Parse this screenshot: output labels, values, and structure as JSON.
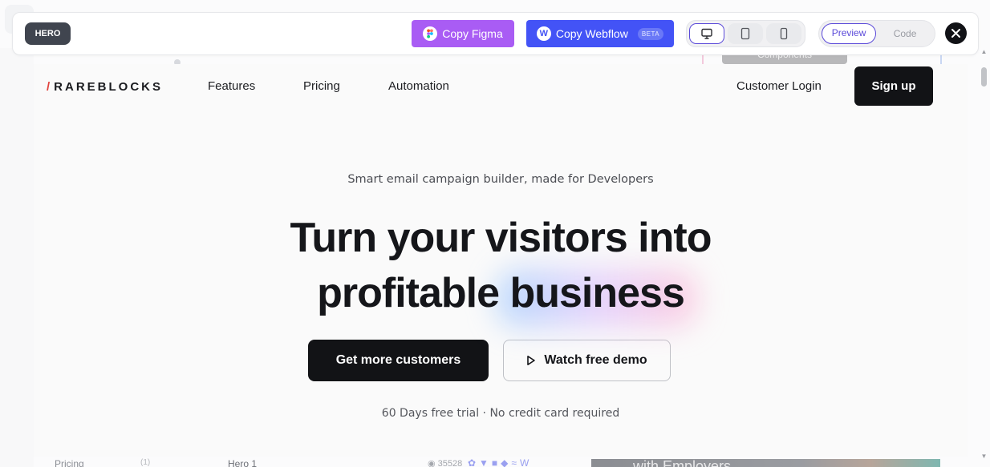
{
  "toolbar": {
    "badge": "HERO",
    "copy_figma": "Copy Figma",
    "copy_webflow": "Copy Webflow",
    "beta": "BETA",
    "devices": [
      "desktop",
      "tablet",
      "mobile"
    ],
    "active_device": "desktop",
    "modes": [
      "Preview",
      "Code"
    ],
    "active_mode": "Preview",
    "accent": "#5b4ad9",
    "figma_color": "#a95cf4",
    "webflow_color": "#4353f6"
  },
  "preview": {
    "nav": {
      "logo_slash": "/",
      "logo_text": "RAREBLOCKS",
      "links": [
        "Features",
        "Pricing",
        "Automation"
      ],
      "login": "Customer Login",
      "signup": "Sign up"
    },
    "hero": {
      "eyebrow": "Smart email campaign builder, made for Developers",
      "headline_line1": "Turn your visitors into",
      "headline_line2_a": "profitable",
      "headline_line2_b": "business",
      "cta_primary": "Get more customers",
      "cta_secondary": "Watch free demo",
      "footnote": "60 Days free trial · No credit card required"
    }
  },
  "background_page": {
    "components_label": "Components",
    "sidebar_item": "Pricing",
    "sidebar_count": "(1)",
    "card_title": "Hero 1",
    "views": "35528",
    "card_teaser": "with Employers"
  }
}
